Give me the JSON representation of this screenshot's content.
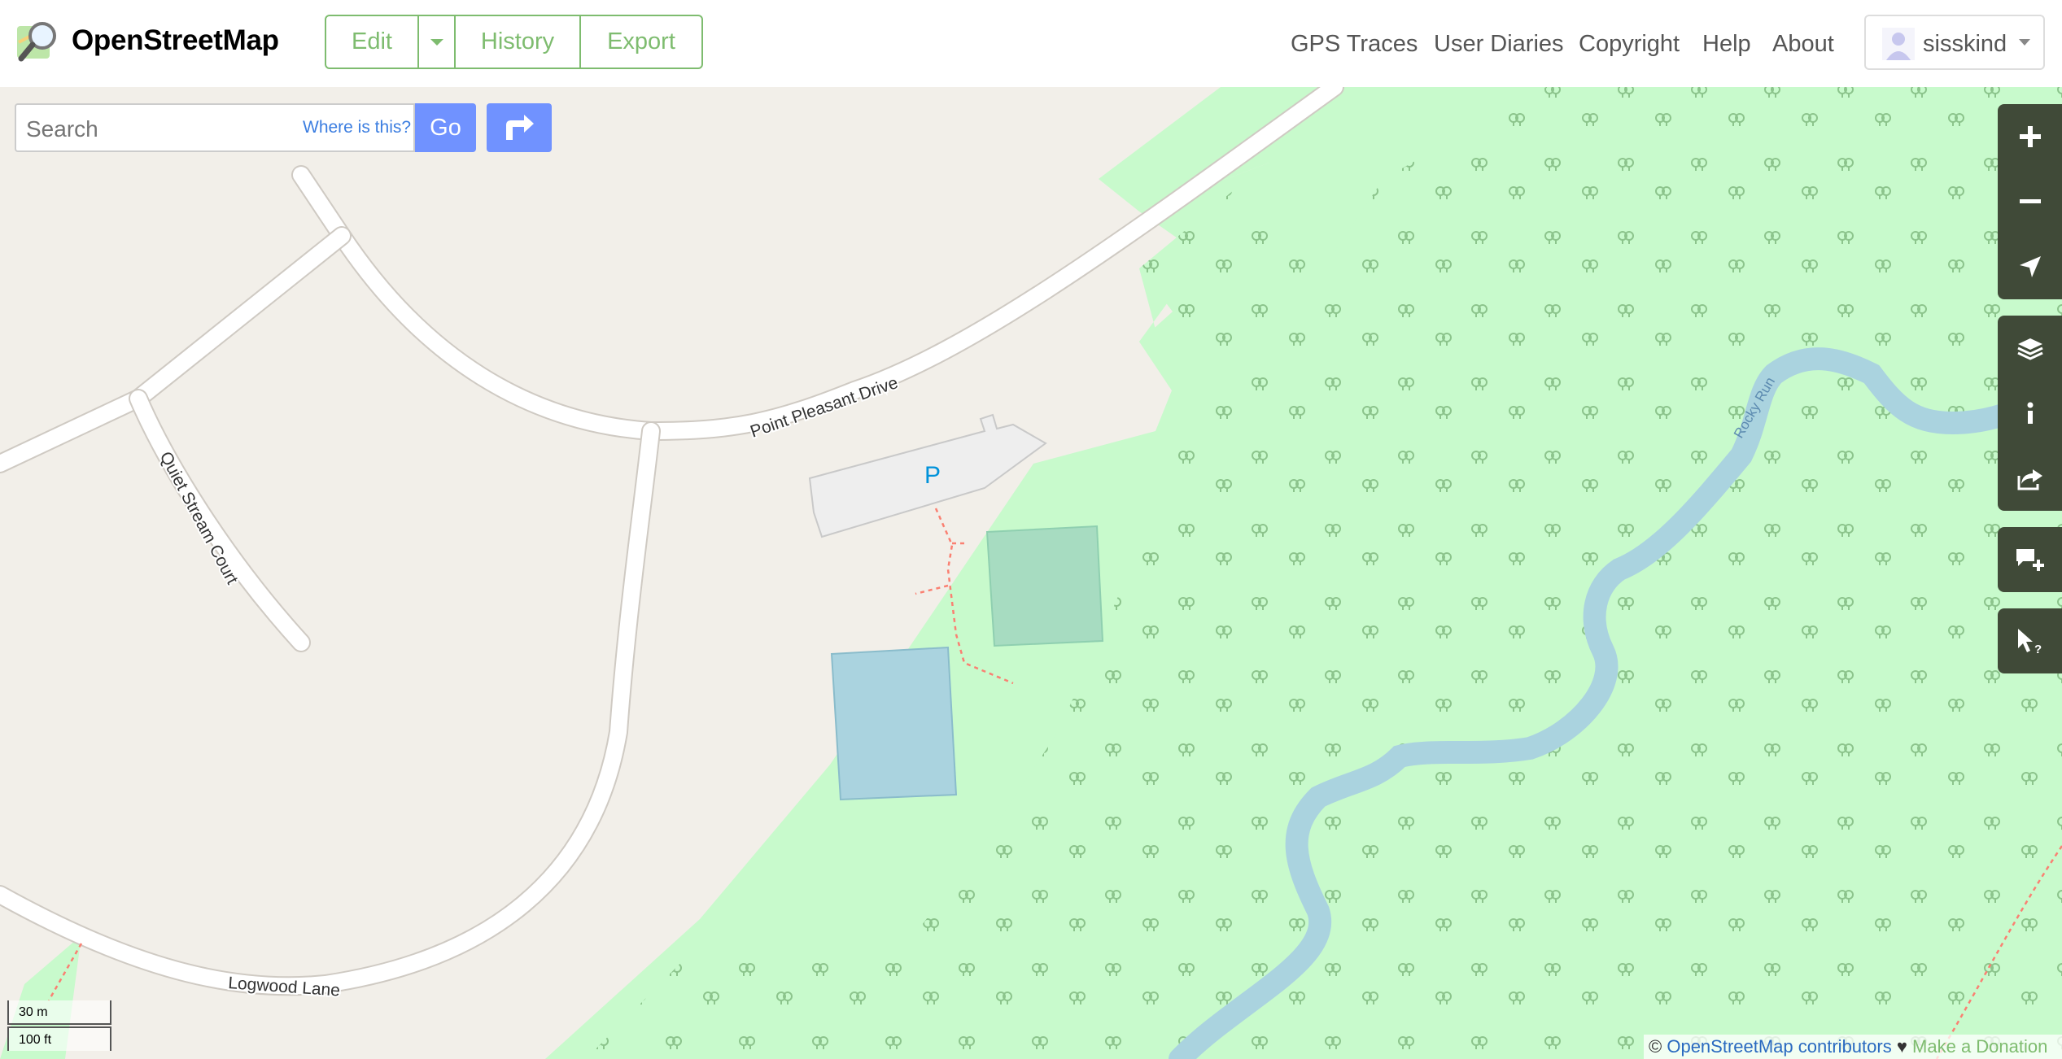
{
  "brand": {
    "name": "OpenStreetMap"
  },
  "toolbar": {
    "edit_label": "Edit",
    "history_label": "History",
    "export_label": "Export"
  },
  "nav": {
    "gps_traces": "GPS Traces",
    "user_diaries": "User Diaries",
    "copyright": "Copyright",
    "help": "Help",
    "about": "About"
  },
  "user": {
    "name": "sisskind"
  },
  "search": {
    "placeholder": "Search",
    "value": "",
    "where_label": "Where is this?",
    "go_label": "Go"
  },
  "map": {
    "labels": {
      "point_pleasant": "Point Pleasant Drive",
      "quiet_stream": "Quiet Stream Court",
      "logwood": "Logwood Lane",
      "rocky_run": "Rocky Run",
      "parking": "P"
    },
    "colors": {
      "land": "#f2efe9",
      "forest": "#c8facc",
      "water": "#aad3df",
      "pitch": "#a7dcc1",
      "road": "#ffffff",
      "parking": "#eeeeee",
      "path": "#fa8072"
    }
  },
  "scale": {
    "metric": "30 m",
    "imperial": "100 ft"
  },
  "attribution": {
    "copyright_symbol": "©",
    "contributors": "OpenStreetMap contributors",
    "heart": "♥",
    "donate": "Make a Donation"
  },
  "controls": {
    "zoom_in_icon": "plus-icon",
    "zoom_out_icon": "minus-icon",
    "locate_icon": "location-arrow-icon",
    "layers_icon": "layers-icon",
    "info_icon": "info-icon",
    "share_icon": "share-icon",
    "note_icon": "add-note-icon",
    "query_icon": "query-features-icon"
  },
  "accent_color": "#7ebc6f",
  "button_color": "#7092ff"
}
